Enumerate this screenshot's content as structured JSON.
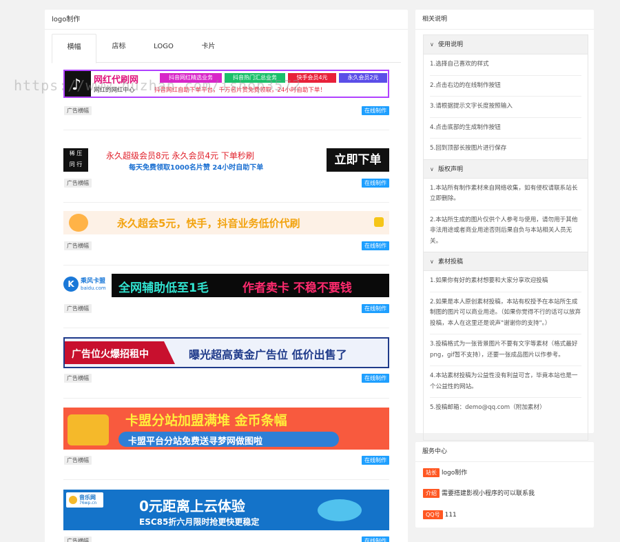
{
  "main": {
    "title": "logo制作",
    "tabs": [
      {
        "label": "横幅"
      },
      {
        "label": "店标"
      },
      {
        "label": "LOGO"
      },
      {
        "label": "卡片"
      }
    ]
  },
  "banners": [
    {
      "texts": {
        "brand": "网红代刷网",
        "sub": "网红的网红中心",
        "b1": "抖音网红精选业务",
        "b2": "抖音热门汇总业务",
        "b3": "快手会员4元",
        "b4": "永久会员2元",
        "ticker": "抖音网红自助下单平台，千万名片赞免费领取，24小时自助下单！"
      },
      "tag": "广告横幅",
      "button": "在线制作"
    },
    {
      "texts": {
        "left1": "稀",
        "left2": "压",
        "left3": "同",
        "left4": "行",
        "line1": "永久超级会员8元  永久会员4元  下单秒刷",
        "line2": "每天免费领取1000名片赞  24小时自助下单",
        "cta": "立即下单"
      },
      "tag": "广告横幅",
      "button": "在线制作"
    },
    {
      "texts": {
        "line": "永久超会5元，快手，抖音业务低价代刷"
      },
      "tag": "广告横幅",
      "button": "在线制作"
    },
    {
      "texts": {
        "logo": "乘风卡盟",
        "domain": "baidu.com",
        "line1": "全网辅助低至1毛",
        "line2": "作者卖卡 不稳不要钱"
      },
      "tag": "广告横幅",
      "button": "在线制作"
    },
    {
      "texts": {
        "left": "广告位火爆招租中",
        "right": "曝光超高黄金广告位 低价出售了"
      },
      "tag": "广告横幅",
      "button": "在线制作"
    },
    {
      "texts": {
        "line1": "卡盟分站加盟满堆 金币条幅",
        "line2": "卡盟平台分站免费送寻梦网做图啦"
      },
      "tag": "广告横幅",
      "button": "在线制作"
    },
    {
      "texts": {
        "logo": "音乐网",
        "domain": "76wp.cn",
        "line1": "0元距离上云体验",
        "line2": "ESC85折六月限时抢更快更稳定"
      },
      "tag": "广告横幅",
      "button": "在线制作"
    }
  ],
  "watermark": "https://www.huzhan.com/ishop3572",
  "sidebar": {
    "title": "相关说明",
    "sections": [
      {
        "heading": "使用说明",
        "items": [
          "1.选择自己喜欢的样式",
          "2.点击右边的在线制作按钮",
          "3.请根据提示文字长度按照输入",
          "4.点击底部的生成制作按钮",
          "5.回到顶部长按图片进行保存"
        ]
      },
      {
        "heading": "版权声明",
        "items": [
          "1.本站所有制作素材来自网络收集，如有侵权请联系站长立即删除。",
          "2.本站所生成的图片仅供个人参考与使用，请勿用于其他非法用途或者商业用途否则后果自负与本站相关人员无关。"
        ]
      },
      {
        "heading": "素材投稿",
        "items": [
          "1.如果你有好的素材想要和大家分享欢迎投稿",
          "2.如果是本人原创素材投稿，本站有权授予在本站所生成制图的图片可以商业用途。（如果你觉得不行的话可以放弃投稿，本人在这里还是说声\"谢谢你的支持\"。）",
          "3.投稿格式为一张背景图片不要有文字等素材（格式最好png，gif暂不支持），还要一张成品图片以作参考。",
          "4.本站素材投稿为公益性没有利益可言，毕竟本站也是一个公益性的网站。",
          "5.投稿邮箱：demo@qq.com（附加素材）"
        ]
      }
    ]
  },
  "service": {
    "title": "服务中心",
    "rows": [
      {
        "badge": "站长",
        "text": "logo制作"
      },
      {
        "badge": "介绍",
        "text": "需要搭建影视小程序的可以联系我"
      },
      {
        "badge": "QQ号",
        "text": "111"
      }
    ]
  },
  "colors": {
    "primary_button": "#1e9fff",
    "badge": "#ff5722",
    "background": "#f2f2f2"
  }
}
